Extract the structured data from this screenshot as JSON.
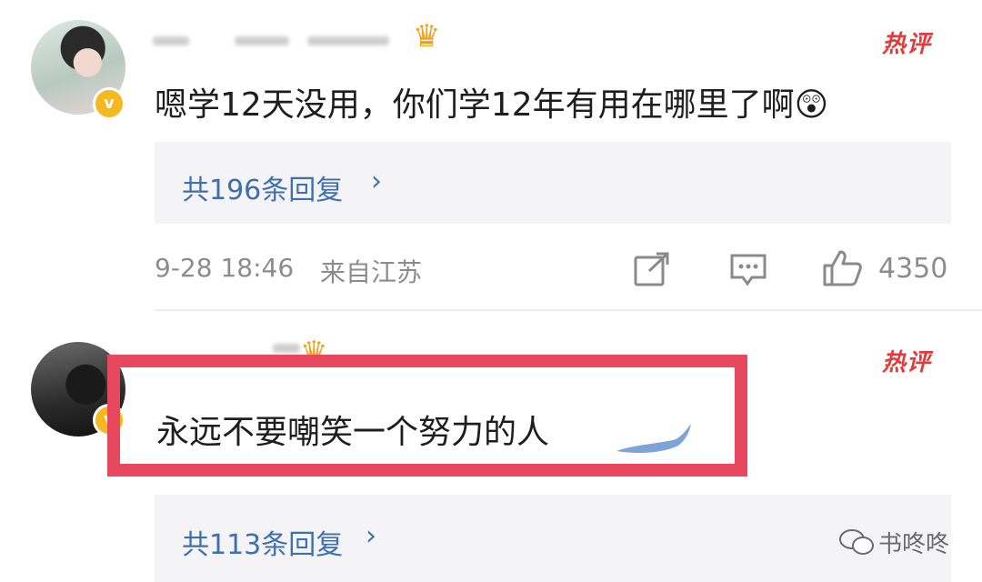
{
  "comments": [
    {
      "text": "嗯学12天没用，你们学12年有用在哪里了啊",
      "emoji": "😲",
      "tag": "热评",
      "replies_label": "共196条回复",
      "timestamp": "9-28 18:46",
      "location": "来自江苏",
      "likes": "4350",
      "verified_mark": "v"
    },
    {
      "text": "永远不要嘲笑一个努力的人",
      "tag": "热评",
      "replies_label": "共113条回复",
      "verified_mark": "v"
    }
  ],
  "icons": {
    "reply_chevron": "›",
    "share": "share-icon",
    "comment": "comment-icon",
    "like": "thumbs-up-icon",
    "crown": "crown-icon"
  },
  "watermark": {
    "text": "书咚咚"
  },
  "colors": {
    "hot_tag": "#e23b3b",
    "reply_link": "#3f6fae",
    "highlight": "#e8485e",
    "verified": "#f5b81f"
  }
}
